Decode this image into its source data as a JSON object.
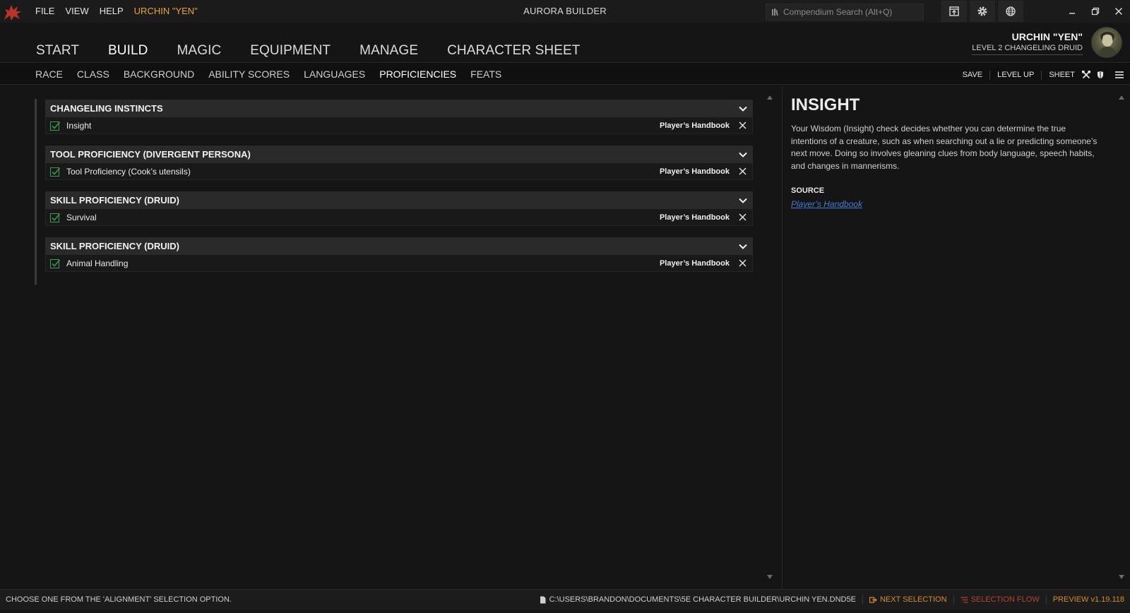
{
  "titlebar": {
    "menu": [
      "FILE",
      "VIEW",
      "HELP"
    ],
    "character_menu": "URCHIN \"YEN\"",
    "app_title": "AURORA BUILDER",
    "search_placeholder": "Compendium Search  (Alt+Q)"
  },
  "main_nav": [
    {
      "label": "START",
      "active": false
    },
    {
      "label": "BUILD",
      "active": true
    },
    {
      "label": "MAGIC",
      "active": false
    },
    {
      "label": "EQUIPMENT",
      "active": false
    },
    {
      "label": "MANAGE",
      "active": false
    },
    {
      "label": "CHARACTER SHEET",
      "active": false
    }
  ],
  "character": {
    "name": "URCHIN \"YEN\"",
    "level": "LEVEL 2 CHANGELING DRUID"
  },
  "sub_nav": [
    {
      "label": "RACE",
      "active": false
    },
    {
      "label": "CLASS",
      "active": false
    },
    {
      "label": "BACKGROUND",
      "active": false
    },
    {
      "label": "ABILITY SCORES",
      "active": false
    },
    {
      "label": "LANGUAGES",
      "active": false
    },
    {
      "label": "PROFICIENCIES",
      "active": true
    },
    {
      "label": "FEATS",
      "active": false
    }
  ],
  "actions": {
    "save": "SAVE",
    "level_up": "LEVEL UP",
    "sheet": "SHEET"
  },
  "groups": [
    {
      "title": "CHANGELING INSTINCTS",
      "item": "Insight",
      "source": "Player’s Handbook"
    },
    {
      "title": "TOOL PROFICIENCY (DIVERGENT PERSONA)",
      "item": "Tool Proficiency (Cook’s utensils)",
      "source": "Player’s Handbook"
    },
    {
      "title": "SKILL PROFICIENCY (DRUID)",
      "item": "Survival",
      "source": "Player’s Handbook"
    },
    {
      "title": "SKILL PROFICIENCY (DRUID)",
      "item": "Animal Handling",
      "source": "Player’s Handbook"
    }
  ],
  "detail": {
    "title": "INSIGHT",
    "description": "Your Wisdom (Insight) check decides whether you can determine the true intentions of a creature, such as when searching out a lie or predicting someone’s next move. Doing so involves gleaning clues from body language, speech habits, and changes in mannerisms.",
    "source_label": "SOURCE",
    "source_link": "Player’s Handbook"
  },
  "status": {
    "message": "CHOOSE ONE FROM THE 'ALIGNMENT' SELECTION OPTION.",
    "file_path": "C:\\USERS\\BRANDON\\DOCUMENTS\\5E CHARACTER BUILDER\\URCHIN YEN.DND5E",
    "next_selection": "NEXT SELECTION",
    "selection_flow": "SELECTION FLOW",
    "preview": "PREVIEW v1.19.118"
  },
  "colors": {
    "accent_orange": "#e8a23c",
    "link_blue": "#3d7fd6",
    "check_green": "#3d9b5a",
    "flow_red": "#b8432e"
  }
}
